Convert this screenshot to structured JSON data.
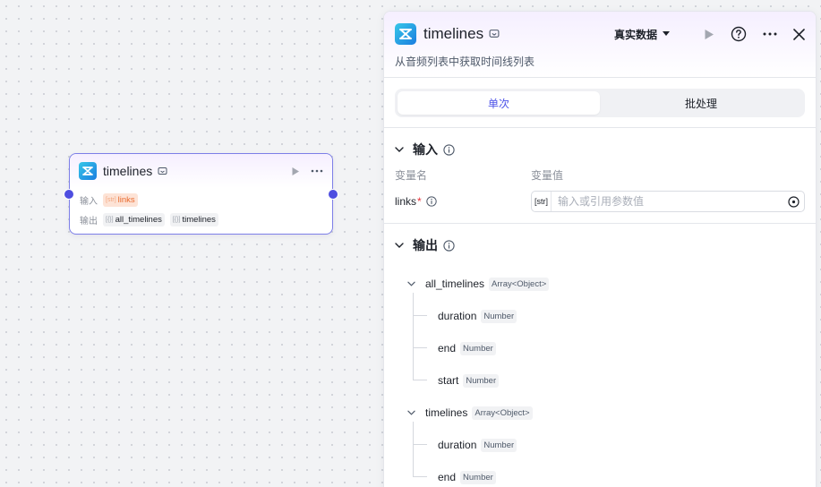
{
  "colors": {
    "accent": "#4d53e8",
    "port": "#4e4ee0",
    "node_border": "#7d7fe8",
    "required": "#e8333a",
    "input_pill": "#e96a2e"
  },
  "node": {
    "title": "timelines",
    "logo_icon": "capcut-logo-icon",
    "input_label": "输入",
    "input_pill": {
      "prefix": "[str]",
      "text": "links"
    },
    "output_label": "输出",
    "output_pills": [
      {
        "prefix": "[{}]",
        "text": "all_timelines"
      },
      {
        "prefix": "[{}]",
        "text": "timelines"
      }
    ]
  },
  "panel": {
    "title": "timelines",
    "subtitle": "从音频列表中获取时间线列表",
    "data_select": "真实数据",
    "tabs": [
      {
        "label": "单次",
        "active": true
      },
      {
        "label": "批处理",
        "active": false
      }
    ],
    "input_section": {
      "title": "输入",
      "col_name": "变量名",
      "col_value": "变量值",
      "var_name": "links",
      "required_mark": "*",
      "type_tag": "[str]",
      "placeholder": "输入或引用参数值"
    },
    "output_section": {
      "title": "输出",
      "fields": [
        {
          "name": "all_timelines",
          "type": "Array<Object>",
          "children": [
            {
              "name": "duration",
              "type": "Number"
            },
            {
              "name": "end",
              "type": "Number"
            },
            {
              "name": "start",
              "type": "Number"
            }
          ]
        },
        {
          "name": "timelines",
          "type": "Array<Object>",
          "children": [
            {
              "name": "duration",
              "type": "Number"
            },
            {
              "name": "end",
              "type": "Number"
            }
          ]
        }
      ]
    }
  }
}
